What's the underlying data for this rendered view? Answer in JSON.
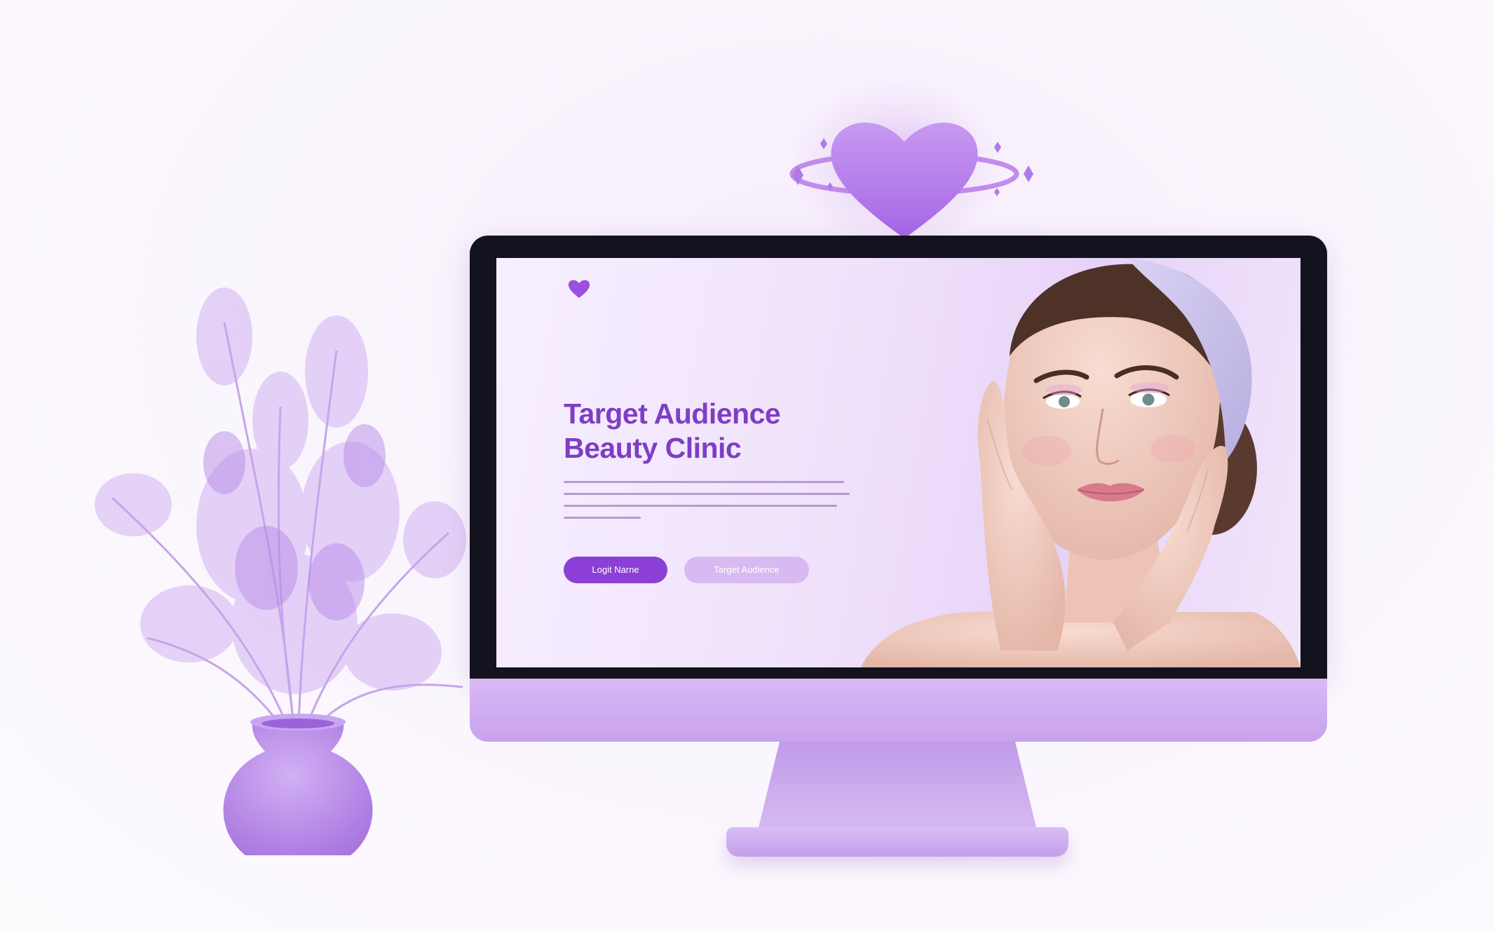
{
  "hero": {
    "title_line1": "Target Audience",
    "title_line2": "Beauty Clinic",
    "primary_button": "Logit Narne",
    "secondary_button": "Target Audience"
  },
  "colors": {
    "accent": "#8b3fd6",
    "title": "#7e3ec4",
    "secondary_button": "#d9b9f2",
    "monitor_bezel": "#13131f",
    "monitor_body": "#d0aef1"
  },
  "icons": [
    "heart-icon",
    "sparkle-icon",
    "orbit-ring-icon"
  ]
}
